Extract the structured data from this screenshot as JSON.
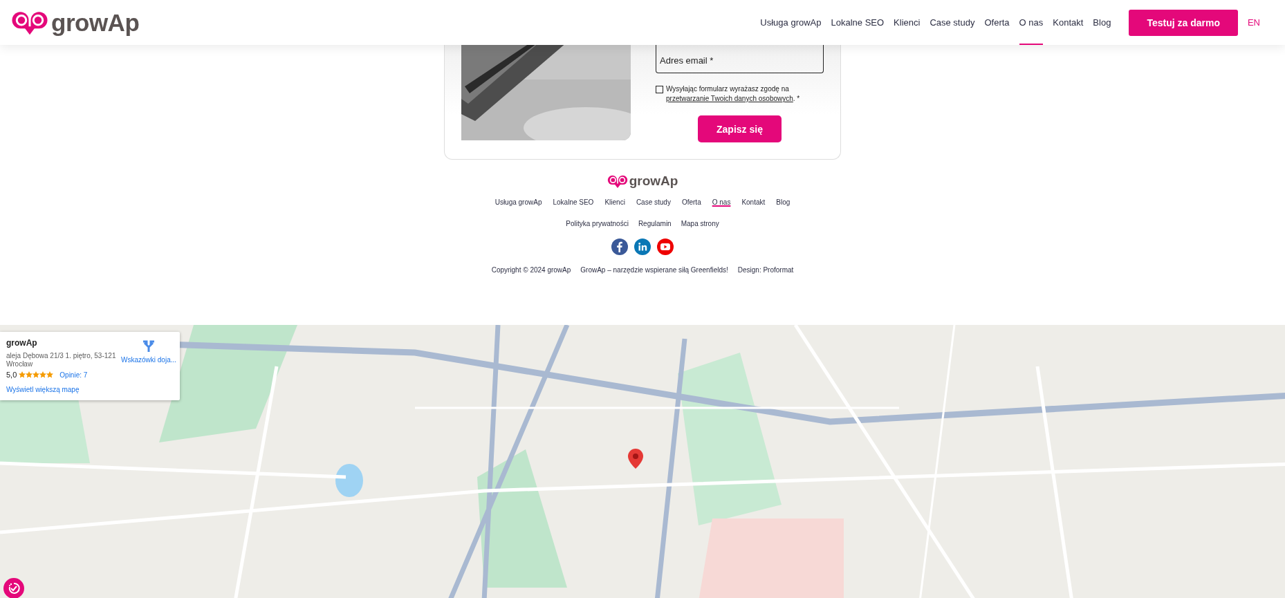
{
  "header": {
    "logo": "growAp",
    "nav": [
      {
        "label": "Usługa growAp",
        "selected": false
      },
      {
        "label": "Lokalne SEO",
        "selected": false
      },
      {
        "label": "Klienci",
        "selected": false
      },
      {
        "label": "Case study",
        "selected": false
      },
      {
        "label": "Oferta",
        "selected": false
      },
      {
        "label": "O nas",
        "selected": true
      },
      {
        "label": "Kontakt",
        "selected": false
      },
      {
        "label": "Blog",
        "selected": false
      }
    ],
    "cta": "Testuj za darmo",
    "language": "EN"
  },
  "signup": {
    "email": {
      "placeholder": "Adres email *"
    },
    "consent": {
      "checked": false,
      "text": "Wysyłając formularz wyrażasz zgodę na",
      "link": "przetwarzanie Twoich danych osobowych",
      "suffix": ". *"
    },
    "submit": "Zapisz się"
  },
  "footer": {
    "logo": "growAp",
    "nav": [
      {
        "label": "Usługa growAp",
        "selected": false
      },
      {
        "label": "Lokalne SEO",
        "selected": false
      },
      {
        "label": "Klienci",
        "selected": false
      },
      {
        "label": "Case study",
        "selected": false
      },
      {
        "label": "Oferta",
        "selected": false
      },
      {
        "label": "O nas",
        "selected": true
      },
      {
        "label": "Kontakt",
        "selected": false
      },
      {
        "label": "Blog",
        "selected": false
      }
    ],
    "legal": [
      "Polityka prywatności",
      "Regulamin",
      "Mapa strony"
    ],
    "social": [
      {
        "kind": "facebook"
      },
      {
        "kind": "linkedin"
      },
      {
        "kind": "youtube"
      }
    ],
    "credits": [
      "Copyright © 2024 growAp",
      "GrowAp – narzędzie wspierane siłą Greenfields!",
      "Design: Proformat"
    ]
  },
  "map": {
    "kind": "picture",
    "card": {
      "title": "growAp",
      "address": "aleja Dębowa 21/3 1. piętro, 53-121 Wrocław",
      "rating": "5,0",
      "stars": 5,
      "reviews": "Opinie: 7",
      "directions": "Wskazówki doja...",
      "larger_map": "Wyświetl większą mapę"
    }
  }
}
